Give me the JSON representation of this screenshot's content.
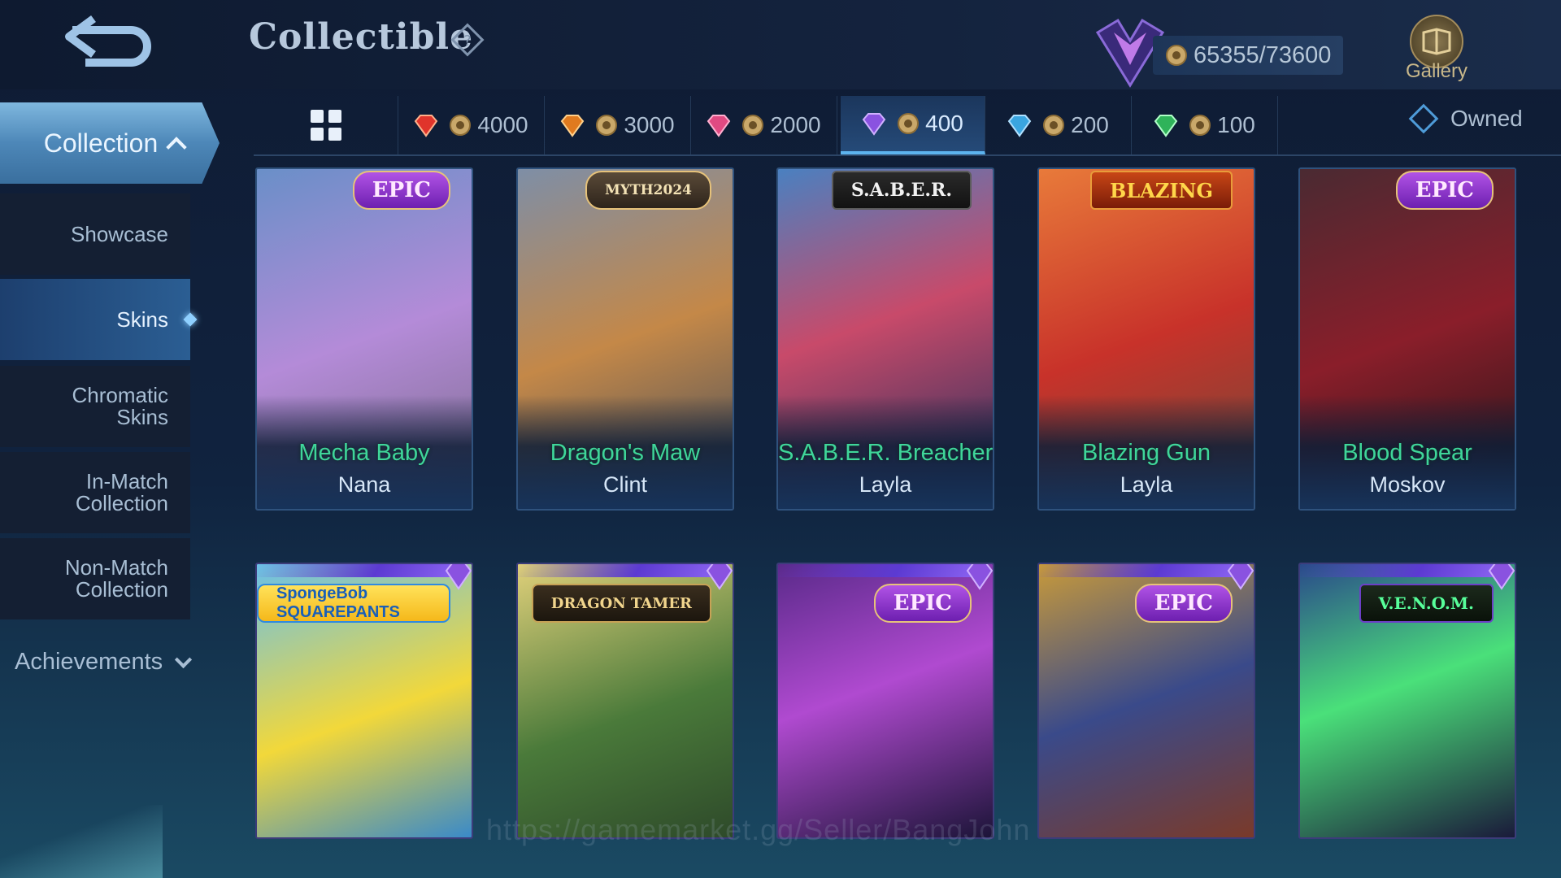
{
  "header": {
    "title": "Collectible",
    "points": "65355/73600",
    "gallery_label": "Gallery",
    "back_icon": "back-arrow-icon",
    "help_icon": "help-icon"
  },
  "sidebar": {
    "collection": "Collection",
    "items": [
      {
        "label_lines": [
          "Showcase"
        ],
        "active": false
      },
      {
        "label_lines": [
          "Skins"
        ],
        "active": true
      },
      {
        "label_lines": [
          "Chromatic",
          "Skins"
        ],
        "active": false
      },
      {
        "label_lines": [
          "In-Match",
          "Collection"
        ],
        "active": false
      },
      {
        "label_lines": [
          "Non-Match",
          "Collection"
        ],
        "active": false
      }
    ],
    "achievements": "Achievements"
  },
  "filters": {
    "tabs": [
      {
        "value": "4000",
        "gem_color": "#e0342b"
      },
      {
        "value": "3000",
        "gem_color": "#e07a1e"
      },
      {
        "value": "2000",
        "gem_color": "#e04a82"
      },
      {
        "value": "400",
        "gem_color": "#8a52e0",
        "active": true
      },
      {
        "value": "200",
        "gem_color": "#3aa5e0"
      },
      {
        "value": "100",
        "gem_color": "#2fb35a"
      }
    ],
    "owned_label": "Owned"
  },
  "cards_top": [
    {
      "skin": "Mecha Baby",
      "hero": "Nana",
      "badge": "EPIC",
      "colors": [
        "#6a8fc8",
        "#b48bd8",
        "#7a6a8a"
      ]
    },
    {
      "skin": "Dragon's Maw",
      "hero": "Clint",
      "badge": "MYTH2024",
      "colors": [
        "#7e8ea6",
        "#c48848",
        "#3e4a5c"
      ]
    },
    {
      "skin": "S.A.B.E.R. Breacher",
      "hero": "Layla",
      "badge": "S.A.B.E.R.",
      "colors": [
        "#4a80c0",
        "#c84a6a",
        "#1d2d5a"
      ]
    },
    {
      "skin": "Blazing Gun",
      "hero": "Layla",
      "badge": "BLAZING",
      "colors": [
        "#e87a3a",
        "#c8322a",
        "#6a4a3a"
      ]
    },
    {
      "skin": "Blood Spear",
      "hero": "Moskov",
      "badge": "EPIC",
      "colors": [
        "#4a2a32",
        "#8a1e2a",
        "#1c1418"
      ]
    }
  ],
  "cards_bottom": [
    {
      "badge": "SpongeBob SQUAREPANTS",
      "colors": [
        "#6ac0e8",
        "#f2d83a",
        "#3a8ac8"
      ]
    },
    {
      "badge": "DRAGON TAMER",
      "colors": [
        "#e0d07a",
        "#4a7a3a",
        "#2e4a2a"
      ]
    },
    {
      "badge": "EPIC",
      "colors": [
        "#5a2a8a",
        "#b04ad0",
        "#1c1438"
      ]
    },
    {
      "badge": "EPIC",
      "colors": [
        "#c89a3a",
        "#3a4a8a",
        "#7a3a2a"
      ]
    },
    {
      "badge": "V.E.N.O.M.",
      "colors": [
        "#2a4a8a",
        "#4ae07a",
        "#1a1a3a"
      ]
    }
  ],
  "watermark": "https://gamemarket.gg/Seller/BangJohn"
}
